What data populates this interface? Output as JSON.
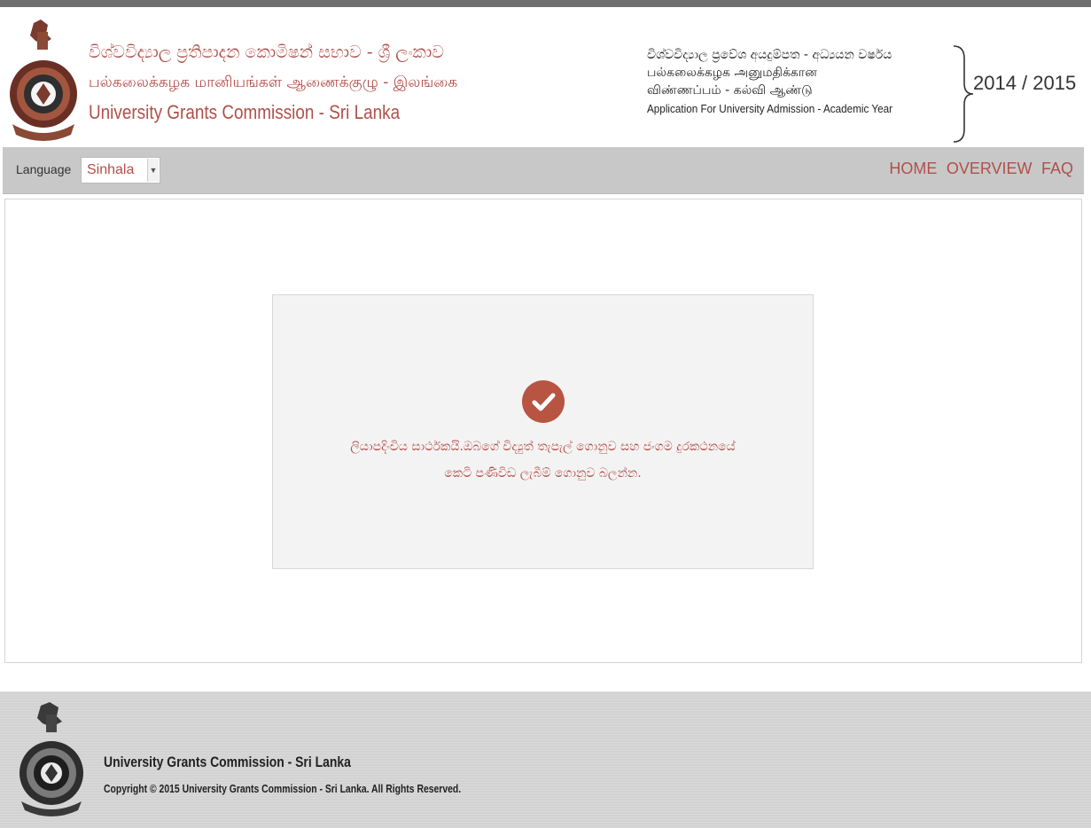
{
  "header": {
    "org_name_si": "විශ්වවිද්‍යාල ප්‍රතිපාදන කොමිෂන් සභාව - ශ්‍රී ලංකාව",
    "org_name_ta": "பல்கலைக்கழக மானியங்கள் ஆணைக்குழு - இலங்கை",
    "org_name_en": "University Grants Commission - Sri Lanka",
    "app_title_si": "විශ්වවිද්‍යාල ප්‍රවේශ අයදුම්පත - අධ්‍යයන වර්ෂය",
    "app_title_ta_1": "பல்கலைக்கழக அனுமதிக்கான",
    "app_title_ta_2": "விண்ணப்பம் - கல்வி ஆண்டு",
    "app_title_en": "Application For University Admission - Academic Year",
    "academic_year": "2014 / 2015"
  },
  "navbar": {
    "language_label": "Language",
    "language_selected": "Sinhala",
    "links": {
      "home": "HOME",
      "overview": "OVERVIEW",
      "faq": "FAQ"
    }
  },
  "message": {
    "line1": "ලියාපදිංචිය සාර්ථකයි.ඔබගේ විද්‍යුත් තැපැල් ගොනුව සහ ජංගම දුරකථනයේ",
    "line2": "කෙටි පණිවිඩ ලැබීම් ගොනුව බලන්න."
  },
  "footer": {
    "title": "University Grants Commission - Sri Lanka",
    "copyright": "Copyright © 2015 University Grants Commission - Sri Lanka. All Rights Reserved."
  },
  "colors": {
    "accent": "#b0504a",
    "check_circle": "#b85442",
    "navbar_bg": "#c8c8c8",
    "footer_bg": "#d2d2d2"
  },
  "icons": {
    "logo": "ugc-emblem-logo",
    "success": "check-circle-icon",
    "dropdown": "chevron-down-icon"
  }
}
